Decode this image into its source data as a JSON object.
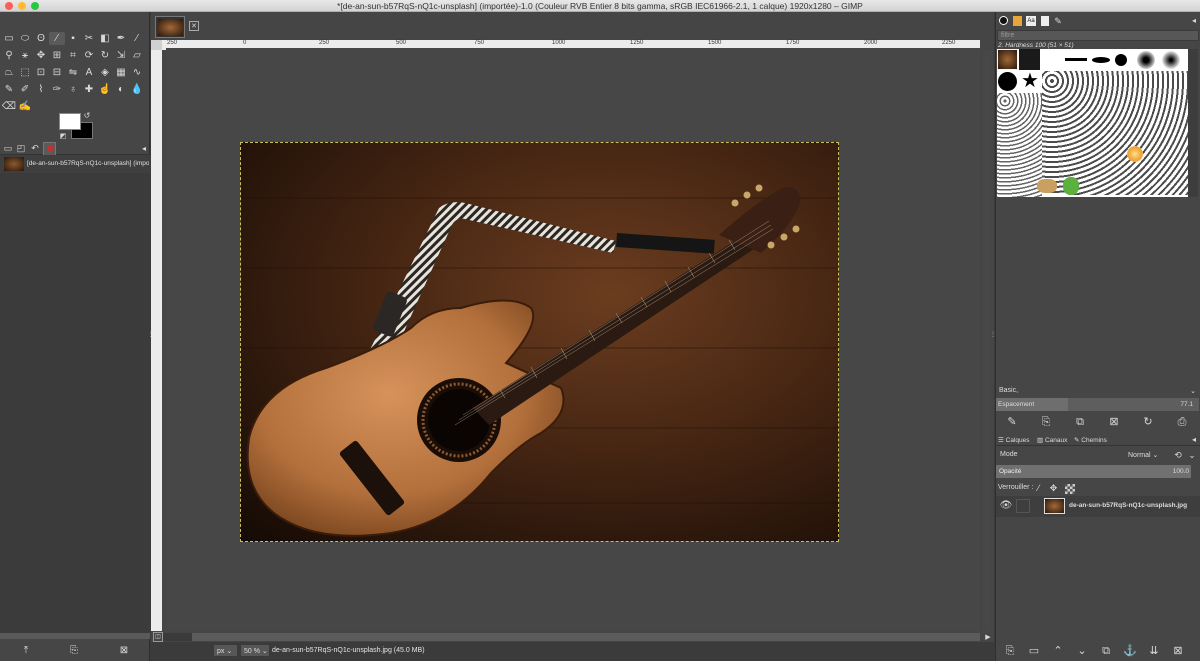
{
  "window": {
    "title": "*[de-an-sun-b57RqS-nQ1c-unsplash] (importée)-1.0 (Couleur RVB Entier 8 bits gamma, sRGB IEC61966-2.1, 1 calque) 1920x1280 – GIMP"
  },
  "image_list": {
    "item_label": "[de-an-sun-b57RqS-nQ1c-unsplash] (impo"
  },
  "ruler": {
    "ticks": [
      "250",
      "0",
      "250",
      "500",
      "750",
      "1000",
      "1250",
      "1500",
      "1750",
      "2000",
      "2250"
    ]
  },
  "statusbar": {
    "unit": "px",
    "zoom": "50 %",
    "info": "de-an-sun-b57RqS-nQ1c-unsplash.jpg (45.0 MB)"
  },
  "brushes": {
    "filter_placeholder": "filtre",
    "current": "2. Hardness 100 (51 × 51)",
    "preset": "Basic,",
    "spacing_label": "Espacement",
    "spacing_value": "77.1"
  },
  "layers": {
    "tabs": [
      "Calques",
      "Canaux",
      "Chemins"
    ],
    "mode_label": "Mode",
    "mode_value": "Normal",
    "opacity_label": "Opacité",
    "opacity_value": "100.0",
    "lock_label": "Verrouiller :",
    "layer_name": "de-an-sun-b57RqS-nQ1c-unsplash.jpg"
  },
  "colors": {
    "accent": "#c9c25a",
    "panel": "#464646"
  }
}
